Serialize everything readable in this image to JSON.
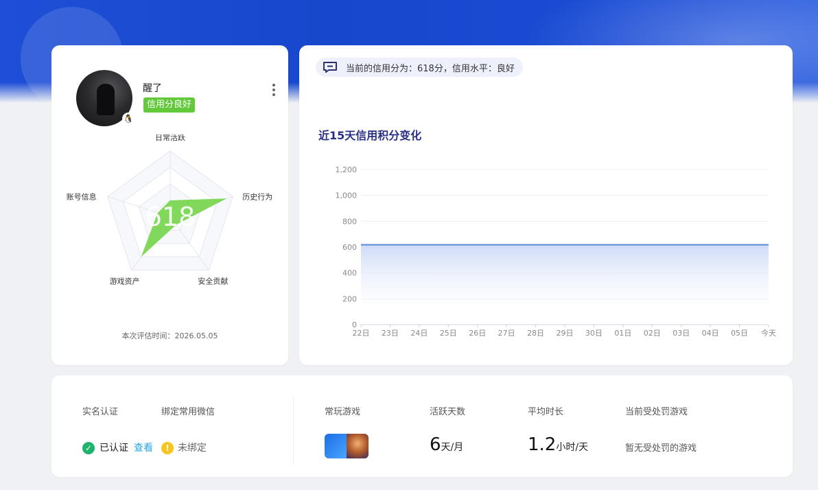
{
  "profile": {
    "username": "醒了",
    "credit_badge": "信用分良好",
    "evaluation_time": "本次评估时间：2026.05.05",
    "radar": {
      "score": "618",
      "axes": [
        "日常活跃",
        "历史行为",
        "安全贡献",
        "游戏资产",
        "账号信息"
      ],
      "values": [
        0.25,
        0.9,
        0.15,
        0.75,
        0.2
      ],
      "fill_color": "#7ad651"
    }
  },
  "tip": {
    "text": "当前的信用分为：618分，信用水平：良好"
  },
  "chart_title": "近15天信用积分变化",
  "chart_data": {
    "type": "area",
    "title": "",
    "x": [
      "22日",
      "23日",
      "24日",
      "25日",
      "26日",
      "27日",
      "28日",
      "29日",
      "30日",
      "01日",
      "02日",
      "03日",
      "04日",
      "05日",
      "今天"
    ],
    "series": [
      {
        "values": [
          618,
          618,
          618,
          618,
          618,
          618,
          618,
          618,
          618,
          618,
          618,
          618,
          618,
          618,
          618
        ]
      }
    ],
    "ylim": [
      0,
      1200
    ],
    "yticks": [
      "0",
      "200",
      "400",
      "600",
      "800",
      "1,000",
      "1,200"
    ],
    "grid": true,
    "line_color": "#5b8ad8"
  },
  "stats": {
    "real_name_label": "实名认证",
    "real_name_status": "已认证",
    "view_link": "查看",
    "wechat_label": "绑定常用微信",
    "wechat_status": "未绑定",
    "common_game_label": "常玩游戏",
    "active_days_label": "活跃天数",
    "active_days_value": "6",
    "active_days_unit": "天/月",
    "avg_duration_label": "平均时长",
    "avg_duration_value": "1.2",
    "avg_duration_unit": "小时/天",
    "penalty_label": "当前受处罚游戏",
    "penalty_value": "暂无受处罚的游戏"
  }
}
